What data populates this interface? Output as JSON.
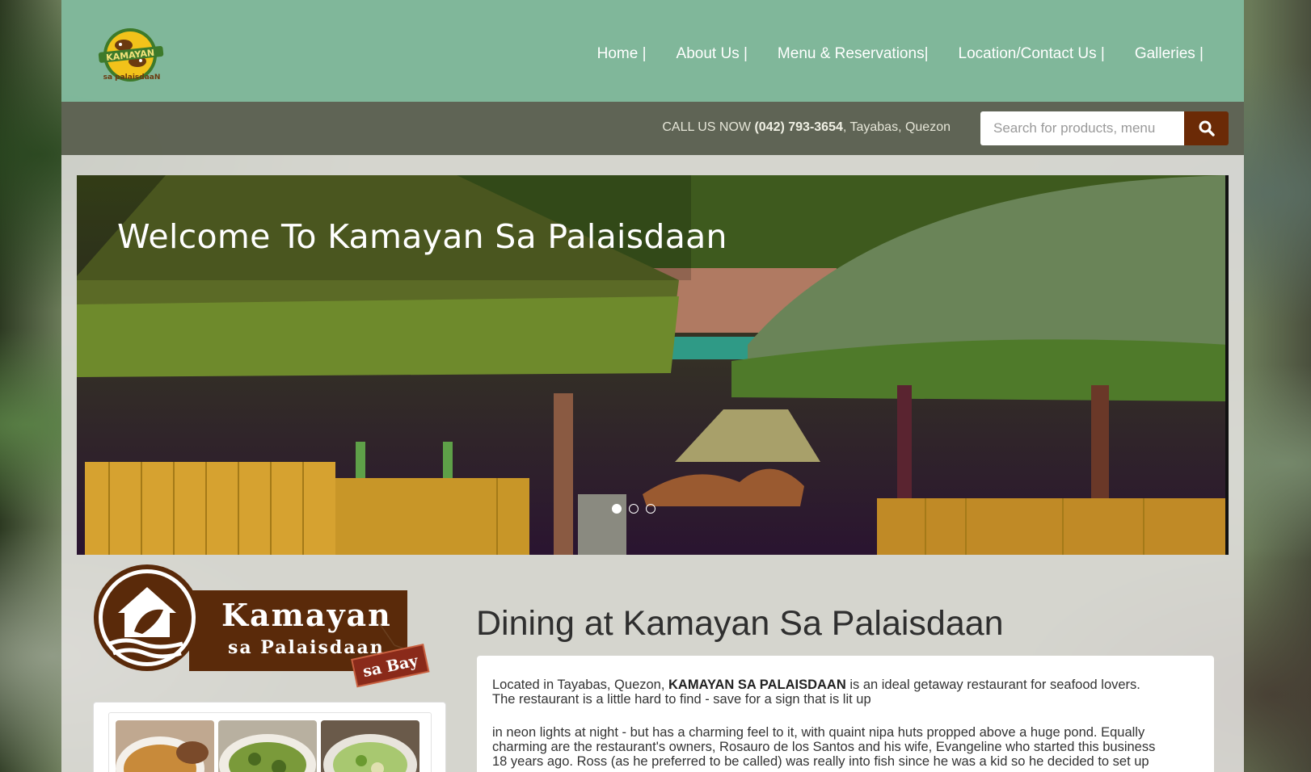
{
  "nav": {
    "items": [
      "Home |",
      "About Us |",
      "Menu & Reservations|",
      "Location/Contact Us |",
      "Galleries |"
    ]
  },
  "callbar": {
    "prefix": "CALL US NOW ",
    "phone": "(042) 793-3654",
    "suffix": ", Tayabas, Quezon"
  },
  "search": {
    "placeholder": "Search for products, menu",
    "icon": "search-icon"
  },
  "hero": {
    "title": "Welcome To Kamayan Sa Palaisdaan",
    "slides_count": 3,
    "active_slide": 1
  },
  "brand": {
    "logo_small_text_top": "KAMAYAN",
    "logo_small_text_bottom": "sa palaisdaaN",
    "logo_line1": "Kamayan",
    "logo_line2": "sa Palaisdaan",
    "logo_tag": "sa Bay"
  },
  "main": {
    "title": "Dining at Kamayan Sa Palaisdaan",
    "intro_before": "Located in Tayabas, Quezon, ",
    "intro_bold": "KAMAYAN SA PALAISDAAN",
    "intro_after": " is an ideal getaway restaurant for seafood lovers.",
    "intro_line2": "The restaurant is a little hard to find - save for a sign that is lit up",
    "body_line1": "in neon lights at night - but has a charming feel to it, with quaint nipa huts propped above a huge pond. Equally",
    "body_line2": "charming are the restaurant's owners, Rosauro de los Santos and his wife, Evangeline who started this business",
    "body_line3": "18 years ago. Ross (as he preferred to be called) was really into fish since he was a kid so he decided to set up"
  },
  "colors": {
    "header": "#78b496",
    "callbar": "#585e4e",
    "accent": "#6b2a06"
  }
}
